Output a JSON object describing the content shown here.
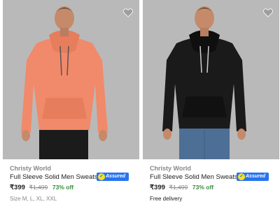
{
  "products": [
    {
      "brand": "Christy World",
      "title": "Full Sleeve Solid Men Sweatshirt",
      "assured_label": "Assured",
      "price": "₹399",
      "mrp": "₹1,499",
      "discount": "73% off",
      "extra_line": "Size M, L, XL, XXL",
      "hoodie_color": "#f08a6a",
      "image_bg": "#b9b9b9"
    },
    {
      "brand": "Christy World",
      "title": "Full Sleeve Solid Men Sweatshirt",
      "assured_label": "Assured",
      "price": "₹399",
      "mrp": "₹1,499",
      "discount": "73% off",
      "extra_line": "Free delivery",
      "hoodie_color": "#1a1a1a",
      "image_bg": "#b9b9b9"
    }
  ],
  "colors": {
    "assured_blue": "#2874f0",
    "discount_green": "#388e3c",
    "muted_gray": "#878787"
  },
  "icons": {
    "wishlist": "heart-icon",
    "assured": "flipkart-assured-icon"
  }
}
